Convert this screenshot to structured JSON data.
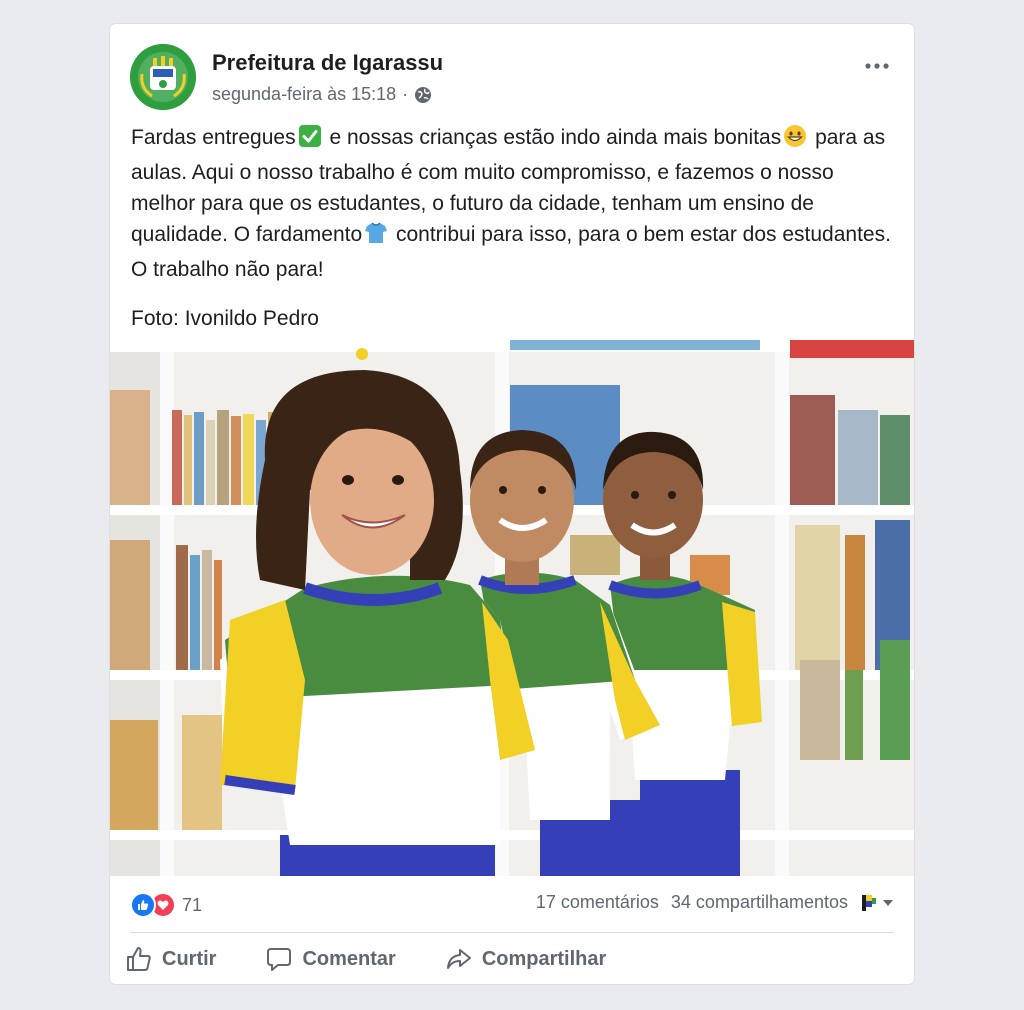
{
  "post": {
    "page_name": "Prefeitura de Igarassu",
    "timestamp": "segunda-feira às 15:18",
    "separator": "·",
    "text_lines": [
      "Fardas entregues",
      " e nossas crianças estão indo ainda mais bonitas",
      "para as aulas. Aqui o nosso trabalho é com muito compromisso, e fazemos o nosso melhor para que os estudantes, o futuro da cidade, tenham um ensino de qualidade. O fardamento",
      " contribui para isso, para o bem estar dos estudantes. O trabalho não para!"
    ],
    "credit": "Foto: Ivonildo Pedro",
    "photo_icon": "photo-children-school-uniforms"
  },
  "stats": {
    "reaction_count": "71",
    "comments": "17 comentários",
    "shares": "34 compartilhamentos"
  },
  "actions": {
    "like": "Curtir",
    "comment": "Comentar",
    "share": "Compartilhar"
  },
  "icons": {
    "check_emoji": "check-mark-button-icon",
    "smile_emoji": "grinning-face-icon",
    "shirt_emoji": "shirt-icon",
    "globe": "globe-icon",
    "more": "more-options-icon"
  },
  "colors": {
    "like_blue": "#1877f2",
    "love_red": "#f33e58",
    "uniform_green": "#4a8c3f",
    "uniform_yellow": "#f2d026",
    "uniform_blue": "#3540b8"
  }
}
